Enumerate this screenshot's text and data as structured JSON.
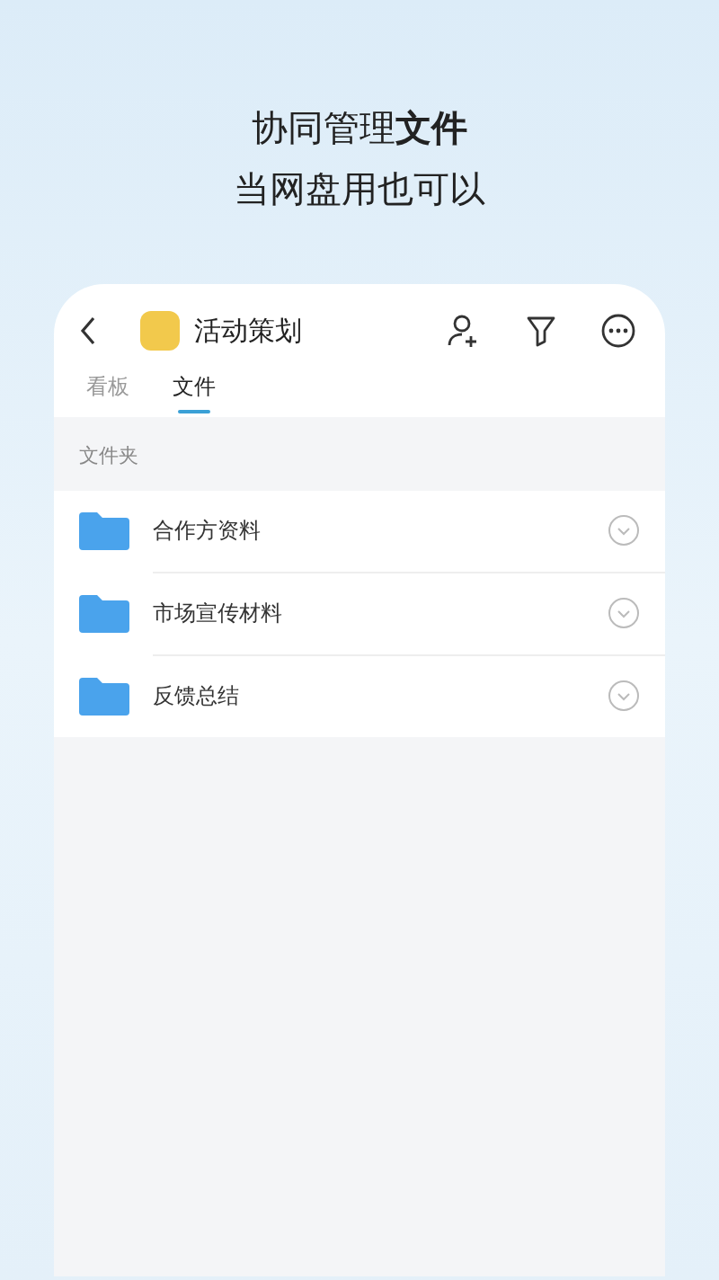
{
  "headline": {
    "line_1": "协同管理**文件**",
    "line_2": "当网盘用也可以"
  },
  "header": {
    "title": "活动策划"
  },
  "tabs": [
    {
      "label": "看板",
      "selected": false
    },
    {
      "label": "文件",
      "selected": true
    }
  ],
  "section_label": "文件夹",
  "folders": [
    {
      "name": "合作方资料"
    },
    {
      "name": "市场宣传材料"
    },
    {
      "name": "反馈总结"
    }
  ]
}
